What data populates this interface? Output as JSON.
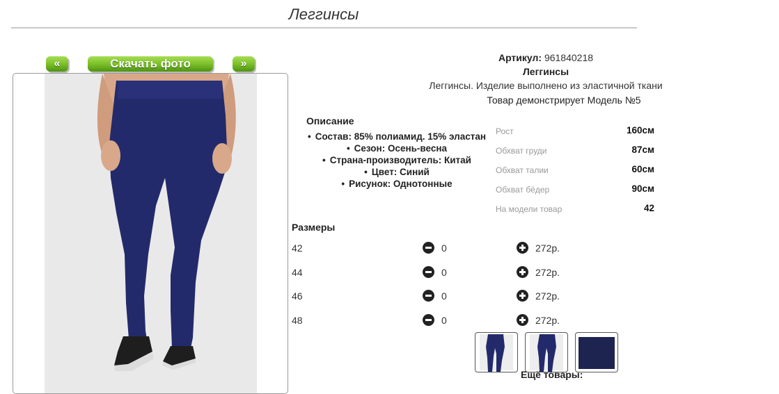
{
  "page": {
    "title": "Леггинсы"
  },
  "photo": {
    "prev_label": "«",
    "download_label": "Скачать фото",
    "next_label": "»"
  },
  "product": {
    "article_label": "Артикул:",
    "article_value": "961840218",
    "name": "Леггинсы",
    "description": "Леггинсы. Изделие выполнено из эластичной ткани",
    "model_note": "Товар демонстрирует Модель №5"
  },
  "description": {
    "title": "Описание",
    "items": [
      "Состав: 85% полиамид. 15% эластан",
      "Сезон: Осень-весна",
      "Страна-производитель: Китай",
      "Цвет: Синий",
      "Рисунок: Однотонные"
    ]
  },
  "measurements": [
    {
      "label": "Рост",
      "value": "160см"
    },
    {
      "label": "Обхват груди",
      "value": "87см"
    },
    {
      "label": "Обхват талии",
      "value": "60см"
    },
    {
      "label": "Обхват бёдер",
      "value": "90см"
    },
    {
      "label": "На модели товар",
      "value": "42"
    }
  ],
  "sizes": {
    "title": "Размеры",
    "rows": [
      {
        "size": "42",
        "qty": "0",
        "price": "272р."
      },
      {
        "size": "44",
        "qty": "0",
        "price": "272р."
      },
      {
        "size": "46",
        "qty": "0",
        "price": "272р."
      },
      {
        "size": "48",
        "qty": "0",
        "price": "272р."
      }
    ]
  },
  "more_label": "Ещё товары:",
  "colors": {
    "button_green": "#7cc02a",
    "legging_navy": "#232a6b",
    "shoe_black": "#1e1e1e"
  }
}
